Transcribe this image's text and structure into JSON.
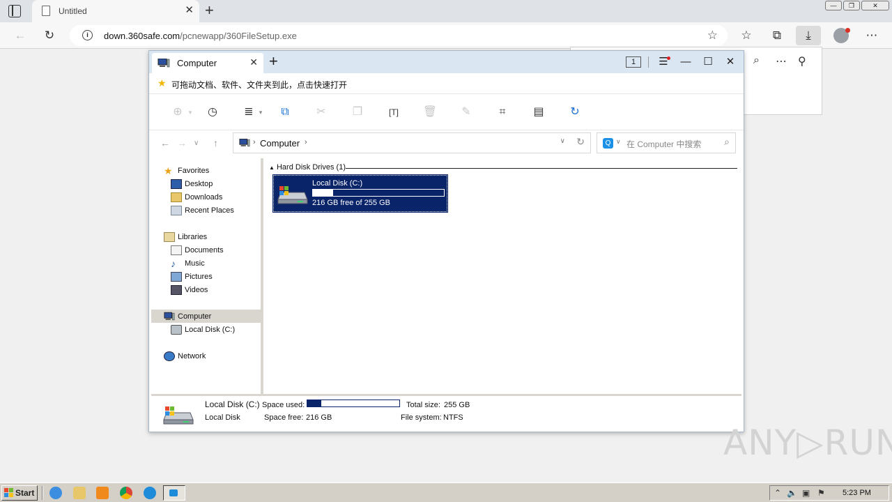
{
  "browser": {
    "tab_title": "Untitled",
    "tab_close": "✕",
    "new_tab": "+",
    "url_host": "down.360safe.com",
    "url_path": "/pcnewapp/360FileSetup.exe",
    "window_buttons": [
      "—",
      "❐",
      "✕"
    ]
  },
  "explorer": {
    "tab_title": "Computer",
    "tab_close": "✕",
    "tab_add": "+",
    "badge": "1",
    "controls": [
      "☰",
      "—",
      "☐",
      "✕"
    ],
    "banner_text": "可拖动文档、软件、文件夹到此，点击快速打开",
    "breadcrumb": "Computer",
    "search_placeholder": "在 Computer 中搜索",
    "sidebar": [
      {
        "label": "Favorites",
        "icon": "star-icon"
      },
      {
        "label": "Desktop",
        "icon": "desktop-icon"
      },
      {
        "label": "Downloads",
        "icon": "downloads-folder-icon"
      },
      {
        "label": "Recent Places",
        "icon": "recent-places-icon"
      },
      {
        "label": "Libraries",
        "icon": "libraries-icon"
      },
      {
        "label": "Documents",
        "icon": "documents-icon"
      },
      {
        "label": "Music",
        "icon": "music-icon"
      },
      {
        "label": "Pictures",
        "icon": "pictures-icon"
      },
      {
        "label": "Videos",
        "icon": "videos-icon"
      },
      {
        "label": "Computer",
        "icon": "computer-icon"
      },
      {
        "label": "Local Disk (C:)",
        "icon": "local-disk-icon"
      },
      {
        "label": "Network",
        "icon": "network-icon"
      }
    ],
    "group_header": "Hard Disk Drives (1)",
    "drive": {
      "name": "Local Disk (C:)",
      "free_text": "216 GB free of 255 GB",
      "used_fraction": 0.153
    },
    "status": {
      "name": "Local Disk (C:)",
      "type": "Local Disk",
      "space_used_label": "Space used:",
      "space_free_label": "Space free:",
      "space_free_value": "216 GB",
      "total_size_label": "Total size:",
      "total_size_value": "255 GB",
      "file_system_label": "File system:",
      "file_system_value": "NTFS",
      "used_fraction": 0.153
    }
  },
  "watermark": "ANY▷RUN",
  "taskbar": {
    "start_label": "Start",
    "clock": "5:23 PM"
  },
  "colors": {
    "selection": "#0a246a",
    "title_bar": "#dbe6f3",
    "taskbar": "#d4d0c8"
  }
}
